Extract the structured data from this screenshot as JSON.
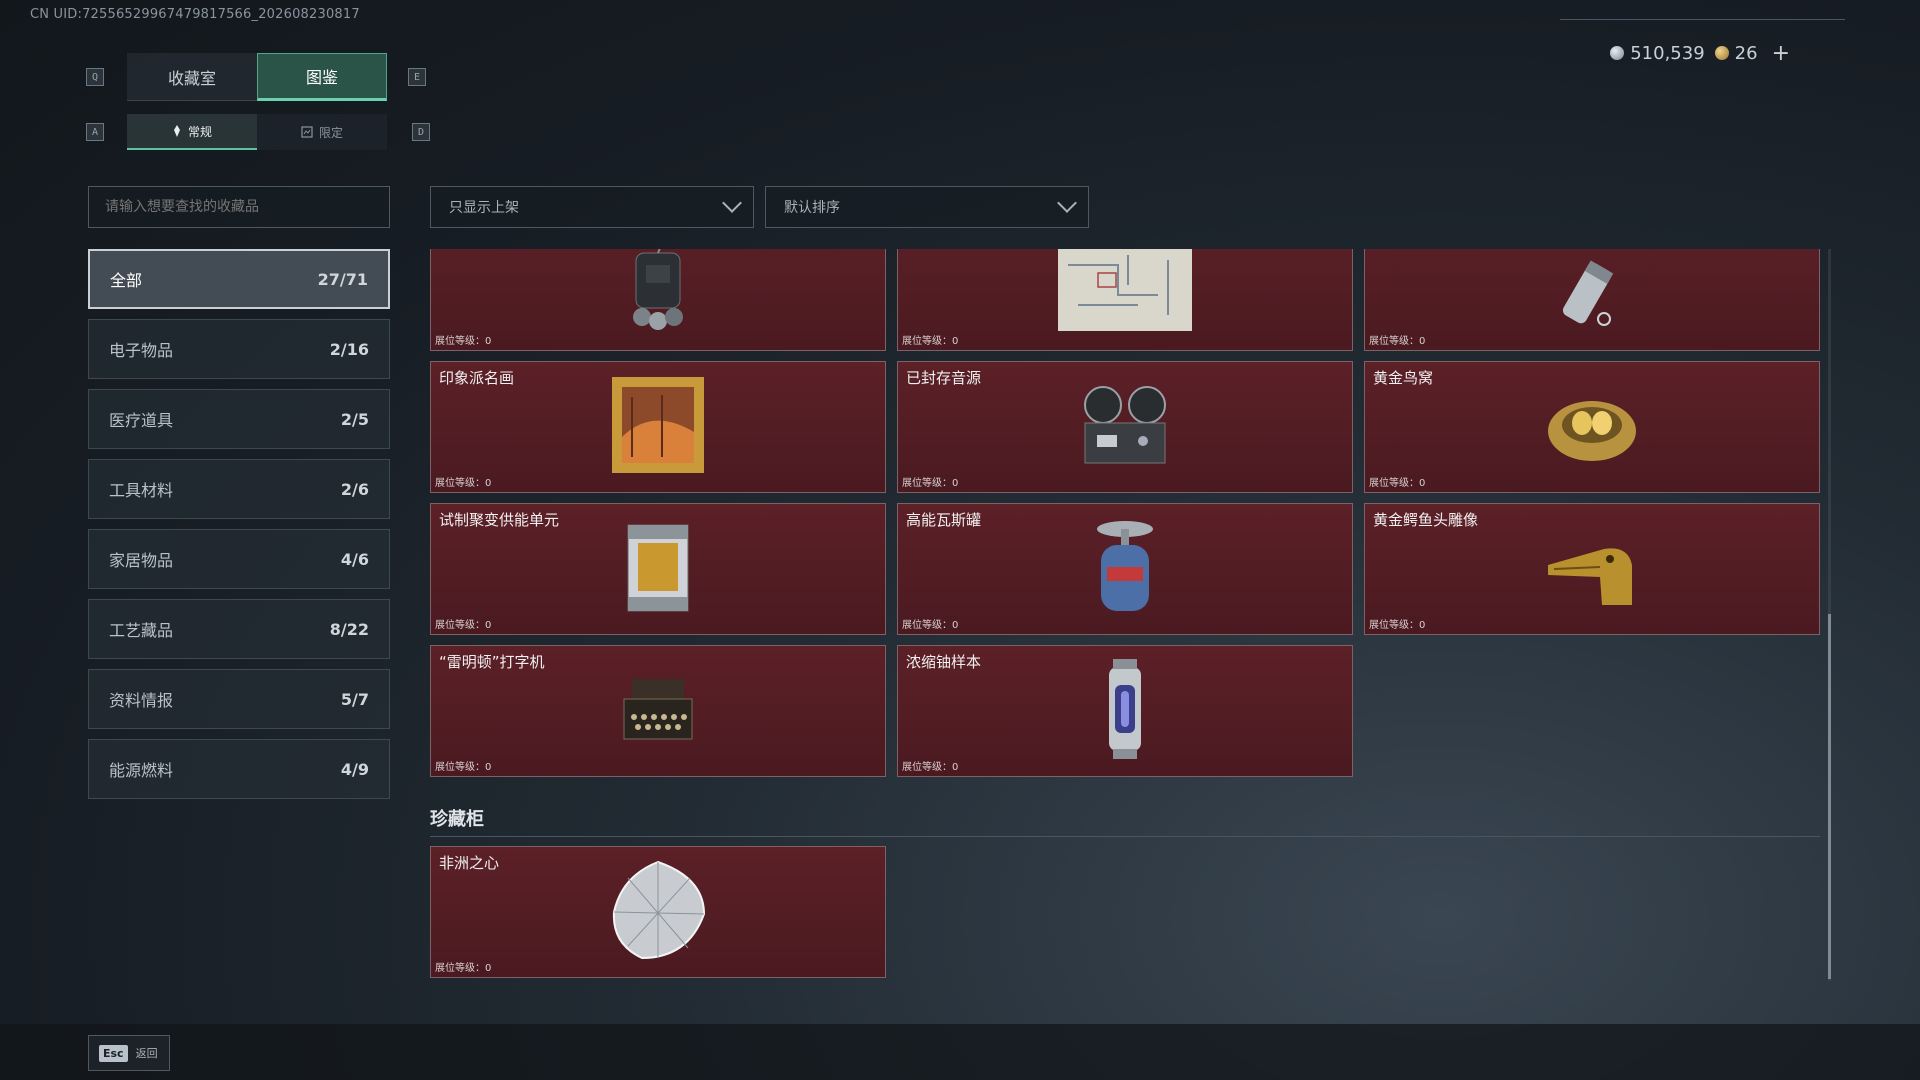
{
  "uid": "CN UID:72556529967479817566_202608230817",
  "currency": {
    "silver": "510,539",
    "gold": "26"
  },
  "keys": {
    "q": "Q",
    "e": "E",
    "a": "A",
    "d": "D"
  },
  "tabs": [
    {
      "label": "收藏室"
    },
    {
      "label": "图鉴"
    }
  ],
  "subtabs": [
    {
      "label": "常规"
    },
    {
      "label": "限定"
    }
  ],
  "search": {
    "placeholder": "请输入想要查找的收藏品"
  },
  "filters": {
    "shelf": "只显示上架",
    "sort": "默认排序"
  },
  "categories": [
    {
      "label": "全部",
      "count": "27/71"
    },
    {
      "label": "电子物品",
      "count": "2/16"
    },
    {
      "label": "医疗道具",
      "count": "2/5"
    },
    {
      "label": "工具材料",
      "count": "2/6"
    },
    {
      "label": "家居物品",
      "count": "4/6"
    },
    {
      "label": "工艺藏品",
      "count": "8/22"
    },
    {
      "label": "资料情报",
      "count": "5/7"
    },
    {
      "label": "能源燃料",
      "count": "4/9"
    }
  ],
  "items": [
    {
      "name": "",
      "level": "展位等级：0",
      "icon": "backpack-radio-icon"
    },
    {
      "name": "",
      "level": "展位等级：0",
      "icon": "blueprint-map-icon"
    },
    {
      "name": "",
      "level": "展位等级：0",
      "icon": "flask-icon"
    },
    {
      "name": "印象派名画",
      "level": "展位等级：0",
      "icon": "painting-icon"
    },
    {
      "name": "已封存音源",
      "level": "展位等级：0",
      "icon": "reel-recorder-icon"
    },
    {
      "name": "黄金鸟窝",
      "level": "展位等级：0",
      "icon": "golden-nest-icon"
    },
    {
      "name": "试制聚变供能单元",
      "level": "展位等级：0",
      "icon": "fusion-cell-icon"
    },
    {
      "name": "高能瓦斯罐",
      "level": "展位等级：0",
      "icon": "gas-canister-icon"
    },
    {
      "name": "黄金鳄鱼头雕像",
      "level": "展位等级：0",
      "icon": "golden-croc-head-icon"
    },
    {
      "name": "“雷明顿”打字机",
      "level": "展位等级：0",
      "icon": "typewriter-icon"
    },
    {
      "name": "浓缩铀样本",
      "level": "展位等级：0",
      "icon": "uranium-sample-icon"
    }
  ],
  "treasure_section": {
    "title": "珍藏柜"
  },
  "treasure_items": [
    {
      "name": "非洲之心",
      "level": "展位等级：0",
      "icon": "diamond-icon"
    }
  ],
  "footer": {
    "esc_key": "Esc",
    "back_label": "返回"
  }
}
